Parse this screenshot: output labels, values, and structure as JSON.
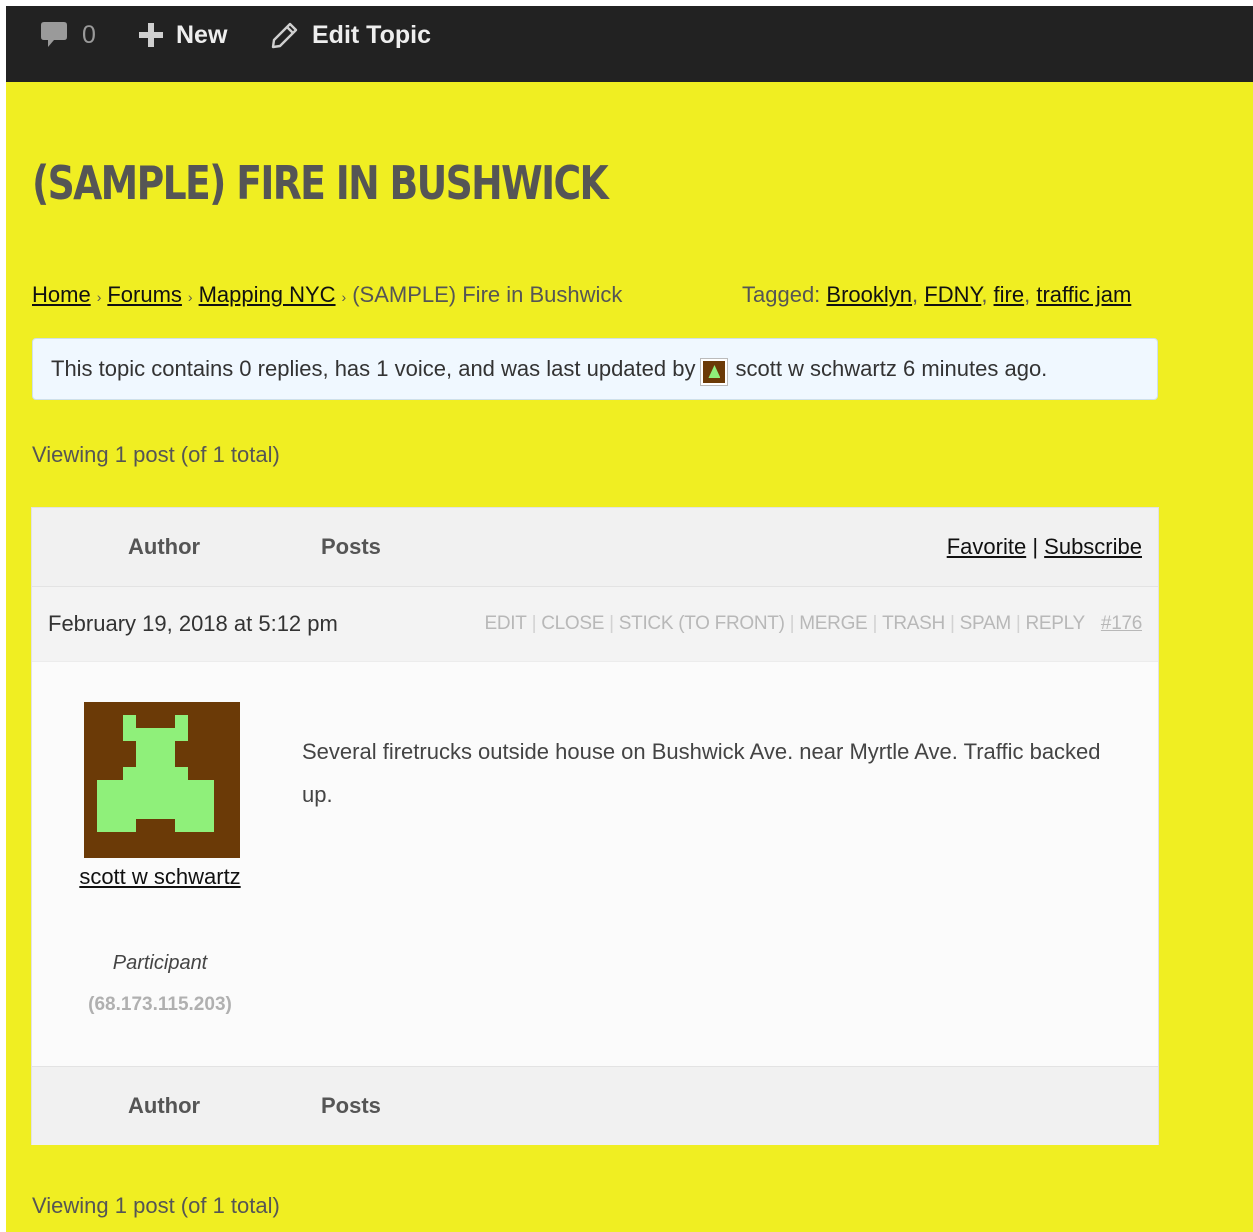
{
  "admin_bar": {
    "comments_count": "0",
    "new_label": "New",
    "edit_label": "Edit Topic"
  },
  "topic": {
    "title": "(SAMPLE) FIRE IN BUSHWICK"
  },
  "breadcrumb": {
    "items": [
      "Home",
      "Forums",
      "Mapping NYC"
    ],
    "current": "(SAMPLE) Fire in Bushwick",
    "separator": "›"
  },
  "tags": {
    "label": "Tagged:",
    "items": [
      "Brooklyn",
      "FDNY",
      "fire",
      "traffic jam"
    ]
  },
  "notice": {
    "text_before": "This topic contains 0 replies, has 1 voice, and was last updated by",
    "author": "scott w schwartz",
    "time": "6 minutes ago."
  },
  "viewing_text": "Viewing 1 post (of 1 total)",
  "table": {
    "col_author": "Author",
    "col_posts": "Posts",
    "favorite": "Favorite",
    "divider": "|",
    "subscribe": "Subscribe"
  },
  "post": {
    "date": "February 19, 2018 at 5:12 pm",
    "admin_links": [
      "EDIT",
      "CLOSE",
      "STICK (TO FRONT)",
      "MERGE",
      "TRASH",
      "SPAM",
      "REPLY"
    ],
    "permalink": "#176",
    "author_name": "scott w schwartz",
    "author_role": "Participant",
    "author_ip": "(68.173.115.203)",
    "content": "Several firetrucks outside house on Bushwick Ave. near Myrtle Ave. Traffic backed up."
  },
  "colors": {
    "page_background": "#f0ee22",
    "admin_bar": "#222222",
    "notice_background": "#f0f8ff",
    "avatar_background": "#6b3a07",
    "avatar_figure": "#8ff07a"
  }
}
